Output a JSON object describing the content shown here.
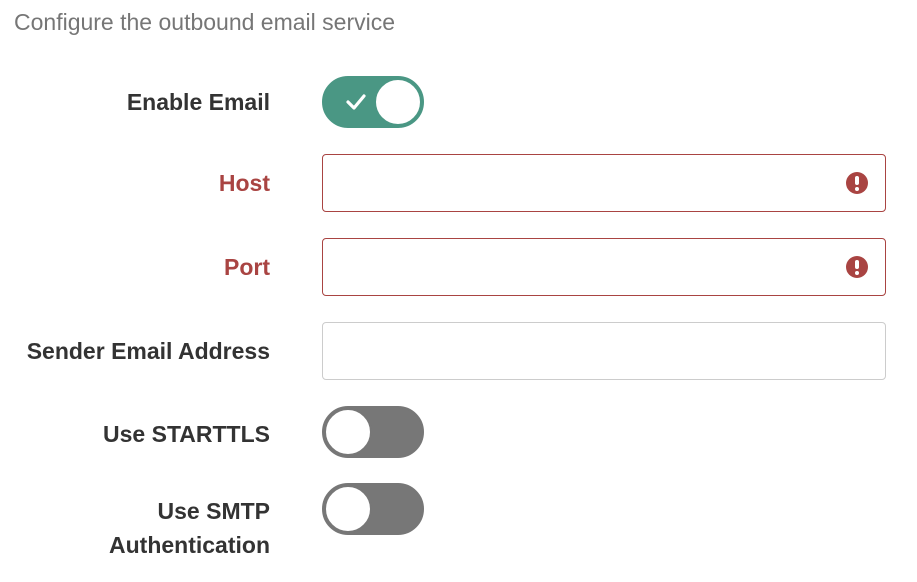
{
  "intro_text": "Configure the outbound email service",
  "fields": {
    "enable_email": {
      "label": "Enable Email",
      "state": "on"
    },
    "host": {
      "label": "Host",
      "value": "",
      "status": "error"
    },
    "port": {
      "label": "Port",
      "value": "",
      "status": "error"
    },
    "sender_email": {
      "label": "Sender Email Address",
      "value": ""
    },
    "use_starttls": {
      "label": "Use STARTTLS",
      "state": "off"
    },
    "use_smtp_auth": {
      "label_line1": "Use SMTP",
      "label_line2": "Authentication",
      "state": "off"
    }
  },
  "icons": {
    "enabled_check": "check-icon",
    "field_error": "exclamation-circle-icon"
  },
  "colors": {
    "toggle_on": "#4a9784",
    "toggle_off": "#777777",
    "error": "#a94442",
    "label": "#333333",
    "intro": "#767676"
  }
}
